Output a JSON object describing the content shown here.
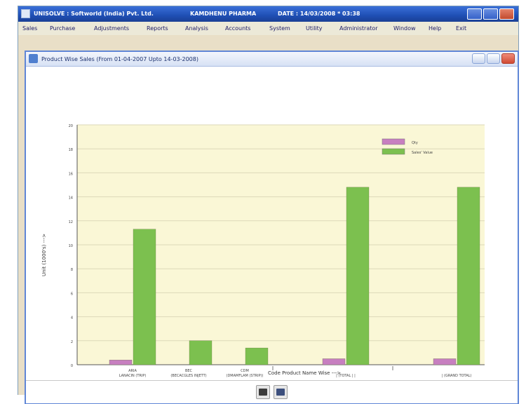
{
  "app": {
    "title": "UNISOLVE : Softworld (India) Pvt. Ltd.",
    "company": "KAMDHENU PHARMA",
    "date": "DATE : 14/03/2008 * 03:38"
  },
  "menu": {
    "items": [
      "Sales",
      "Purchase",
      "Adjustments",
      "Reports",
      "Analysis",
      "Accounts",
      "System",
      "Utility",
      "Administrator",
      "Window",
      "Help",
      "Exit"
    ]
  },
  "child": {
    "title": "Product Wise Sales (From 01-04-2007 Upto 14-03-2008)"
  },
  "chart_data": {
    "type": "bar",
    "ylabel": "Unit (1000's) --->",
    "xlabel": "Code Product Name Wise --->",
    "ylim": [
      0,
      20
    ],
    "yticks": [
      0,
      2,
      4,
      6,
      8,
      10,
      12,
      14,
      16,
      18,
      20
    ],
    "legend": {
      "placement": "top-right"
    },
    "grid": true,
    "categories": [
      {
        "line1": "ARIA",
        "line2": "LANACIN (TRIP)"
      },
      {
        "line1": "BEC",
        "line2": "(BECACGLES INJETT)"
      },
      {
        "line1": "CDM",
        "line2": "(DMAMFLAM (STRIP))"
      },
      {
        "line1": "",
        "line2": "| (TOTAL | |"
      },
      {
        "line1": "",
        "line2": "| (GRAND TOTAL)"
      }
    ],
    "series": [
      {
        "name": "Qty",
        "color": "#c77fc0",
        "values": [
          0.4,
          0,
          0,
          0.5,
          0.5
        ]
      },
      {
        "name": "Sales' Value",
        "color": "#7cc04f",
        "values": [
          11.3,
          2.0,
          1.4,
          14.8,
          14.8
        ]
      }
    ]
  },
  "toolbar": {
    "print_icon": "printer-icon",
    "exit_icon": "exit-icon"
  }
}
